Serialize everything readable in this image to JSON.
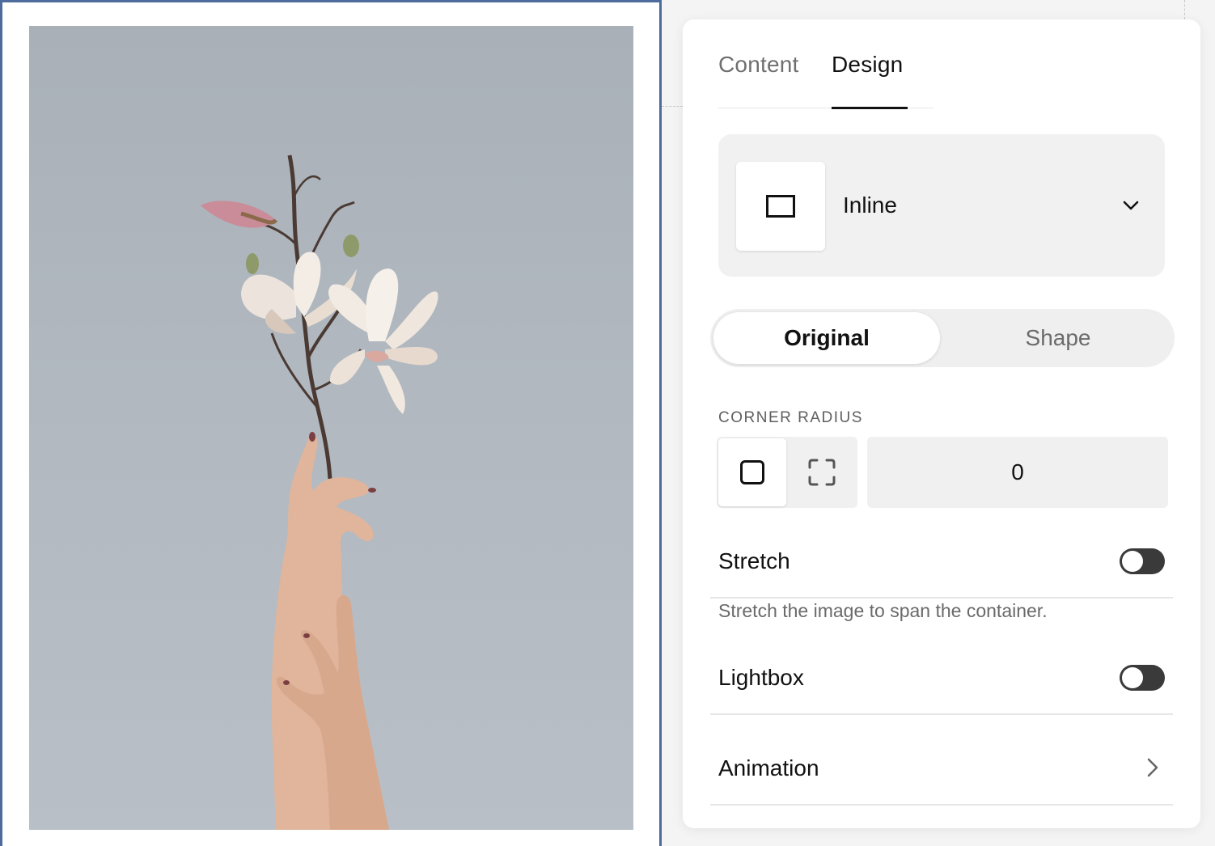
{
  "tabs": [
    {
      "label": "Content",
      "active": false
    },
    {
      "label": "Design",
      "active": true
    }
  ],
  "layout": {
    "selected": "Inline",
    "icon": "inline-layout-icon"
  },
  "crop_mode": {
    "options": [
      "Original",
      "Shape"
    ],
    "selected": "Original"
  },
  "corner_radius": {
    "label": "CORNER RADIUS",
    "mode_icons": [
      "all-corners-icon",
      "individual-corners-icon"
    ],
    "value": "0"
  },
  "stretch": {
    "label": "Stretch",
    "enabled": false,
    "help": "Stretch the image to span the container."
  },
  "lightbox": {
    "label": "Lightbox",
    "enabled": false
  },
  "animation": {
    "label": "Animation",
    "icon": "chevron-right-icon"
  },
  "colors": {
    "selection_outline": "#4d6b9c",
    "toggle_track": "#3a3a3a",
    "photo_background": "#b1b8c0"
  }
}
